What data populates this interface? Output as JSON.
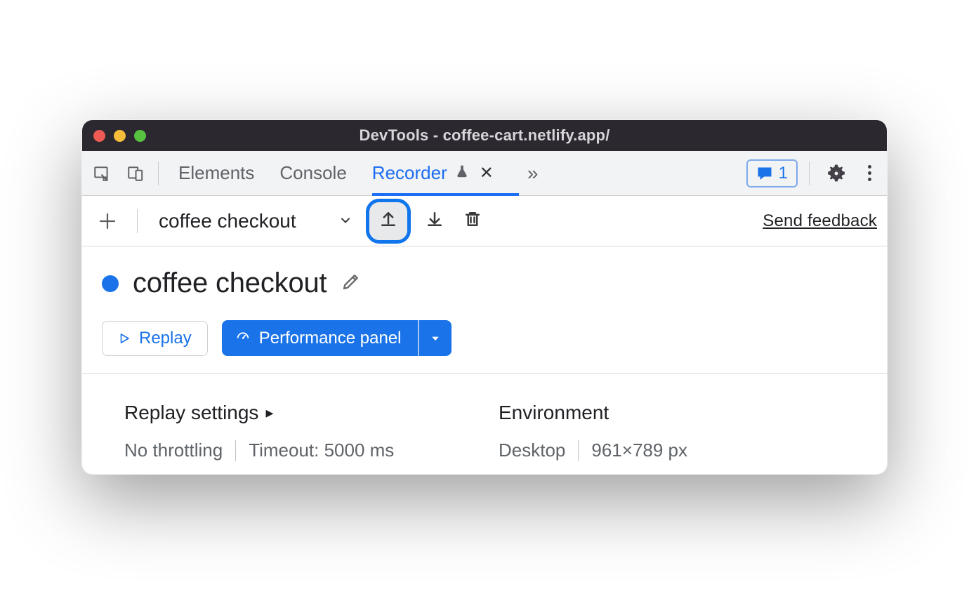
{
  "titlebar": {
    "title": "DevTools - coffee-cart.netlify.app/"
  },
  "tabs": {
    "items": [
      {
        "label": "Elements",
        "active": false
      },
      {
        "label": "Console",
        "active": false
      },
      {
        "label": "Recorder",
        "active": true
      }
    ]
  },
  "messages_badge": {
    "count": "1"
  },
  "toolbar": {
    "recording_name": "coffee checkout",
    "feedback_link": "Send feedback"
  },
  "recording": {
    "title": "coffee checkout",
    "replay_label": "Replay",
    "perf_label": "Performance panel"
  },
  "settings": {
    "replay": {
      "heading": "Replay settings",
      "throttling": "No throttling",
      "timeout": "Timeout: 5000 ms"
    },
    "env": {
      "heading": "Environment",
      "device": "Desktop",
      "dimensions": "961×789 px"
    }
  }
}
